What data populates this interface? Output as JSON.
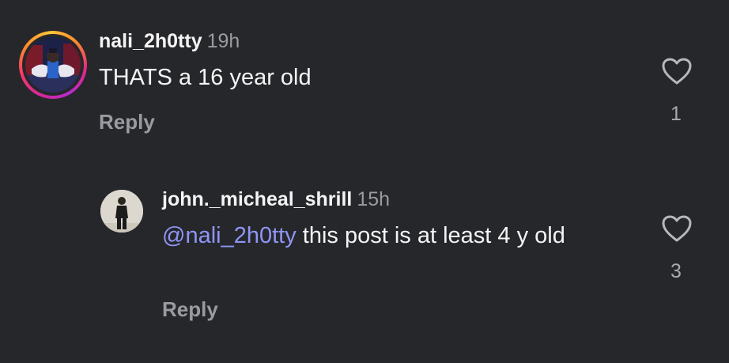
{
  "comments": [
    {
      "username": "nali_2h0tty",
      "timestamp": "19h",
      "text": "THATS a 16 year old",
      "reply_label": "Reply",
      "like_count": "1"
    }
  ],
  "replies": [
    {
      "username": "john._micheal_shrill",
      "timestamp": "15h",
      "mention": "@nali_2h0tty",
      "text": " this post is at least 4 y old",
      "reply_label": "Reply",
      "like_count": "3"
    }
  ],
  "colors": {
    "background": "#26272b",
    "mention": "#8f95f4",
    "secondary_text": "#9a9ba0"
  },
  "icons": {
    "like": "heart-outline-icon",
    "story_ring": "story-ring-gradient"
  }
}
